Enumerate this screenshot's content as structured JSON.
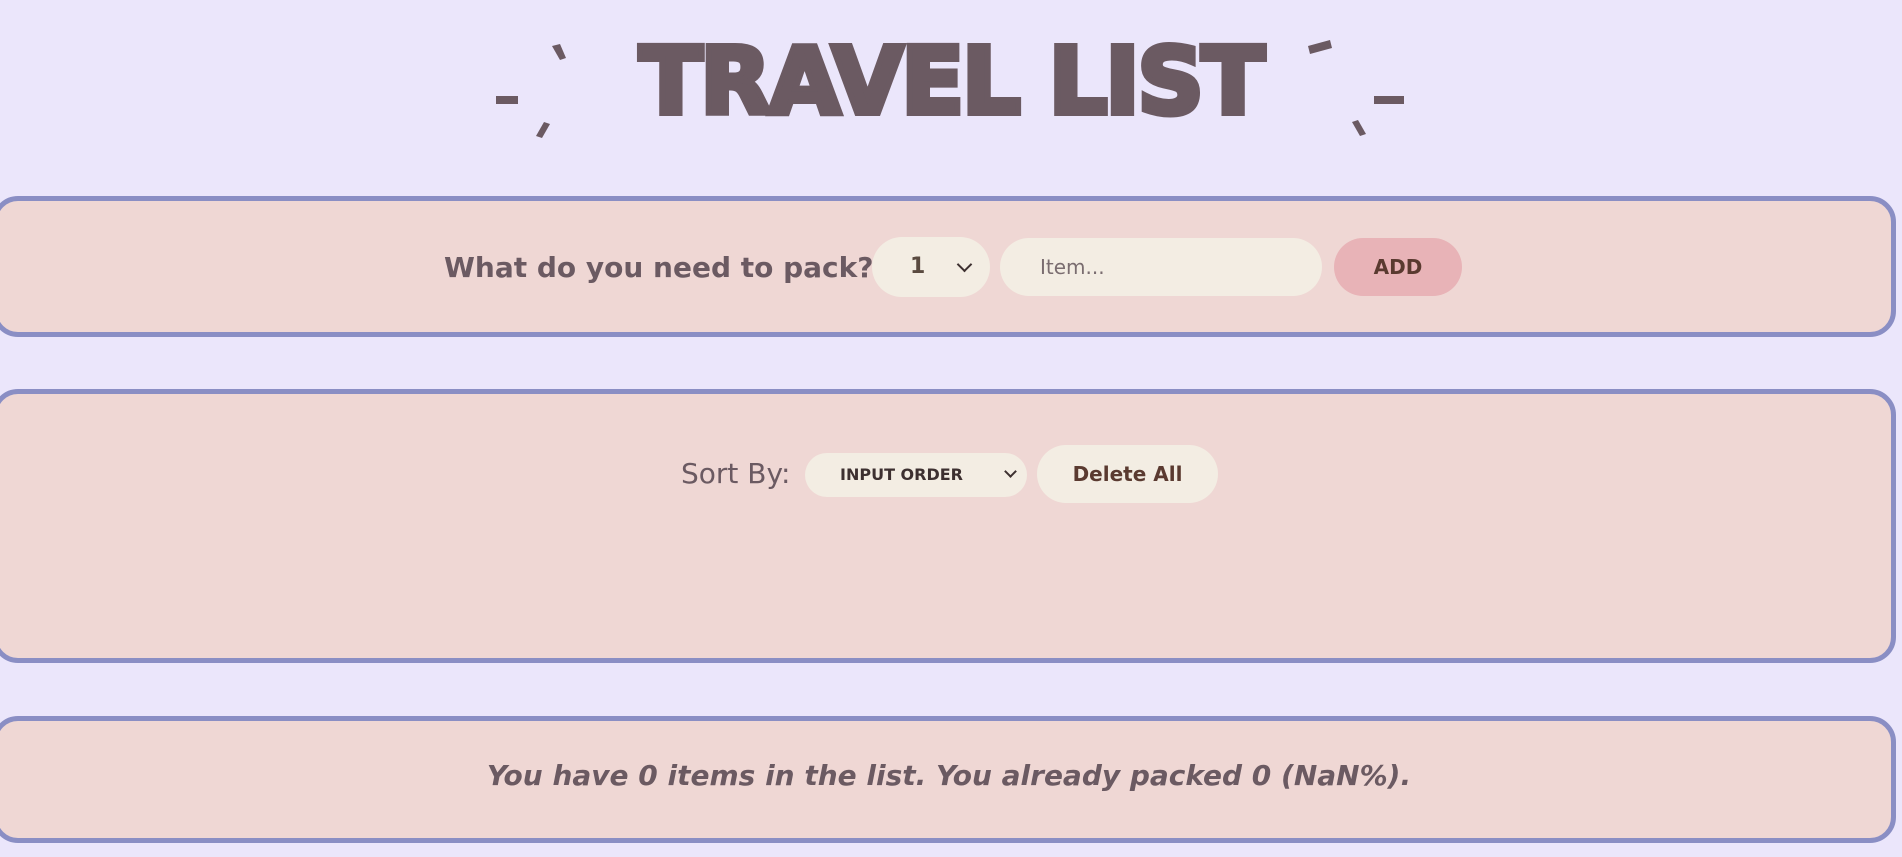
{
  "header": {
    "title": "TRAVEL LIST"
  },
  "add_form": {
    "label": "What do you need to pack?",
    "quantity_value": "1",
    "item_placeholder": "Item...",
    "item_value": "",
    "add_label": "ADD"
  },
  "list": {
    "sort_label": "Sort By:",
    "sort_value": "INPUT ORDER",
    "delete_all_label": "Delete All",
    "items": []
  },
  "stats": {
    "text": "You have 0 items in the list. You already packed 0 (NaN%)."
  },
  "colors": {
    "background": "#ebe6fb",
    "panel": "#efd7d4",
    "panel_border": "#8a8ec4",
    "text": "#6b5a62",
    "input": "#f3ede3",
    "add_button": "#e8b3b7"
  },
  "icons": {
    "title_decorations": "sparkle-icon",
    "select_caret": "chevron-down-icon"
  }
}
